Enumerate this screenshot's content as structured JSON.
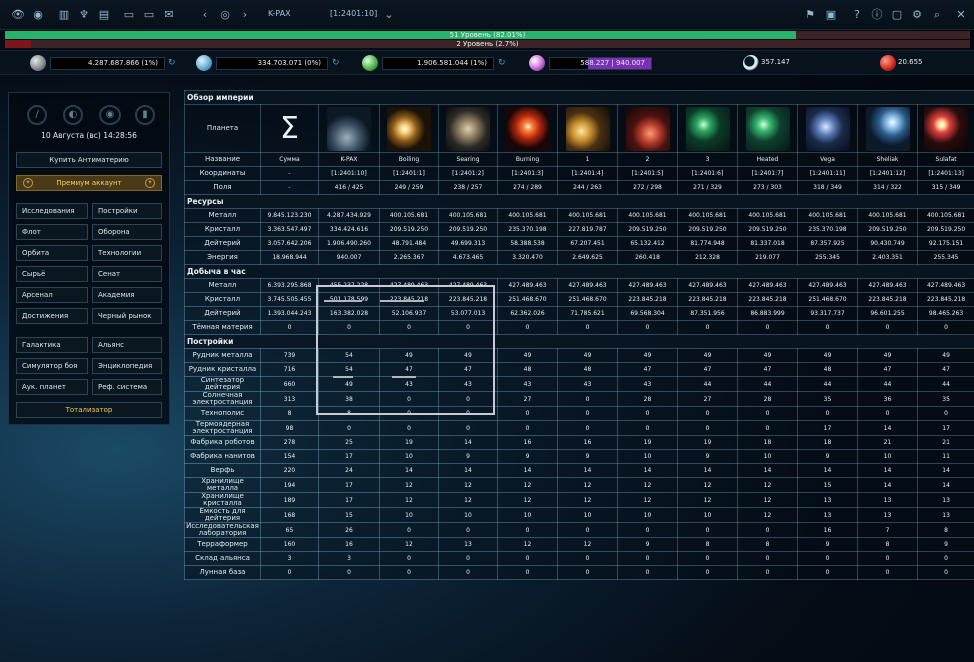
{
  "topbar": {
    "planet_name": "K-PAX",
    "coords": "[1:2401:10]"
  },
  "levels": {
    "level1": "51 Уровень (82.01%)",
    "level1_pct": 82.01,
    "level2": "2 Уровень (2.7%)",
    "level2_pct": 2.7,
    "level1_color": "#27b36b",
    "level2_color": "#7c161a"
  },
  "resources": [
    {
      "name": "metal",
      "icon": "metal-icon",
      "value": "4.287.687.866 (1%)"
    },
    {
      "name": "crystal",
      "icon": "crystal-icon",
      "value": "334.703.071 (0%)"
    },
    {
      "name": "deuterium",
      "icon": "deuterium-icon",
      "value": "1.906.581.044 (1%)"
    },
    {
      "name": "energy",
      "icon": "energy-icon",
      "value": "588.227",
      "max": "940.007",
      "fill_pct": 38
    },
    {
      "name": "dark-matter",
      "icon": "dark-matter-icon",
      "value": "357.147"
    },
    {
      "name": "antimatter",
      "icon": "antimatter-icon",
      "value": "20.655"
    }
  ],
  "sidebar": {
    "datetime": "10 Августа (вс) 14:28:56",
    "buy": "Купить Антиматерию",
    "premium": "Премиум аккаунт",
    "nav": [
      "Исследования",
      "Постройки",
      "Флот",
      "Оборона",
      "Орбита",
      "Технологии",
      "Сырьё",
      "Сенат",
      "Арсенал",
      "Академия",
      "Достижения",
      "Черный рынок"
    ],
    "nav2": [
      "Галактика",
      "Альянс",
      "Симулятор боя",
      "Энциклопедия",
      "Аук. планет",
      "Реф. система"
    ],
    "totalizator": "Тотализатор"
  },
  "overview": {
    "title": "Обзор империи",
    "planet_label": "Планета",
    "sigma": "Σ",
    "rows": [
      {
        "label": "Название",
        "values": [
          "Сумма",
          "K-PAX",
          "Boiling",
          "Searing",
          "Burning",
          "1",
          "2",
          "3",
          "Heated",
          "Vega",
          "Sheliak",
          "Sulafat"
        ]
      },
      {
        "label": "Координаты",
        "values": [
          "-",
          "[1:2401:10]",
          "[1:2401:1]",
          "[1:2401:2]",
          "[1:2401:3]",
          "[1:2401:4]",
          "[1:2401:5]",
          "[1:2401:6]",
          "[1:2401:7]",
          "[1:2401:11]",
          "[1:2401:12]",
          "[1:2401:13]"
        ]
      },
      {
        "label": "Поля",
        "values": [
          "-",
          "416 / 425",
          "249 / 259",
          "238 / 257",
          "274 / 289",
          "244 / 263",
          "272 / 298",
          "271 / 329",
          "273 / 303",
          "318 / 349",
          "314 / 322",
          "315 / 349"
        ]
      }
    ]
  },
  "resources_section": {
    "title": "Ресурсы",
    "rows": [
      {
        "label": "Металл",
        "values": [
          "9.845.123.230",
          "4.287.434.929",
          "400.105.681",
          "400.105.681",
          "400.105.681",
          "400.105.681",
          "400.105.681",
          "400.105.681",
          "400.105.681",
          "400.105.681",
          "400.105.681",
          "400.105.681"
        ]
      },
      {
        "label": "Кристалл",
        "values": [
          "3.363.547.497",
          "334.424.616",
          "209.519.250",
          "209.519.250",
          "235.370.198",
          "227.819.787",
          "209.519.250",
          "209.519.250",
          "209.519.250",
          "235.370.198",
          "209.519.250",
          "209.519.250"
        ]
      },
      {
        "label": "Дейтерий",
        "values": [
          "3.057.642.206",
          "1.906.490.260",
          "48.791.484",
          "49.699.313",
          "58.388.538",
          "67.207.451",
          "65.132.412",
          "81.774.948",
          "81.337.018",
          "87.357.925",
          "90.430.749",
          "92.175.151"
        ]
      },
      {
        "label": "Энергия",
        "values": [
          "18.968.944",
          "940.007",
          "2.265.367",
          "4.673.465",
          "3.320.470",
          "2.649.625",
          "260.418",
          "212.328",
          "219.077",
          "255.345",
          "2.403.351",
          "255.345"
        ]
      }
    ]
  },
  "production_section": {
    "title": "Добыча в час",
    "rows": [
      {
        "label": "Металл",
        "values": [
          "6.393.295.868",
          "455.237.228",
          "427.489.463",
          "427.489.463",
          "427.489.463",
          "427.489.463",
          "427.489.463",
          "427.489.463",
          "427.489.463",
          "427.489.463",
          "427.489.463",
          "427.489.463"
        ]
      },
      {
        "label": "Кристалл",
        "values": [
          "3.745.505.455",
          "501.178.599",
          "223.845.218",
          "223.845.218",
          "251.468.670",
          "251.468.670",
          "223.845.218",
          "223.845.218",
          "223.845.218",
          "251.468.670",
          "223.845.218",
          "223.845.218"
        ]
      },
      {
        "label": "Дейтерий",
        "values": [
          "1.393.044.243",
          "163.382.028",
          "52.106.937",
          "53.077.013",
          "62.362.026",
          "71.785.621",
          "69.568.304",
          "87.351.956",
          "86.883.999",
          "93.317.737",
          "96.601.255",
          "98.465.263"
        ]
      },
      {
        "label": "Тёмная материя",
        "values": [
          "0",
          "0",
          "0",
          "0",
          "0",
          "0",
          "0",
          "0",
          "0",
          "0",
          "0",
          "0"
        ]
      }
    ]
  },
  "buildings_section": {
    "title": "Постройки",
    "rows": [
      {
        "label": "Рудник металла",
        "values": [
          "739",
          "54",
          "49",
          "49",
          "49",
          "49",
          "49",
          "49",
          "49",
          "49",
          "49",
          "49"
        ]
      },
      {
        "label": "Рудник кристалла",
        "values": [
          "716",
          "54",
          "47",
          "47",
          "48",
          "48",
          "47",
          "47",
          "47",
          "48",
          "47",
          "47"
        ]
      },
      {
        "label": "Синтезатор дейтерия",
        "values": [
          "660",
          "49",
          "43",
          "43",
          "43",
          "43",
          "43",
          "44",
          "44",
          "44",
          "44",
          "44"
        ]
      },
      {
        "label": "Солнечная электростанция",
        "values": [
          "313",
          "38",
          "0",
          "0",
          "27",
          "0",
          "28",
          "27",
          "28",
          "35",
          "36",
          "35"
        ]
      },
      {
        "label": "Технополис",
        "values": [
          "8",
          "8",
          "0",
          "0",
          "0",
          "0",
          "0",
          "0",
          "0",
          "0",
          "0",
          "0"
        ]
      },
      {
        "label": "Термоядерная электростанция",
        "values": [
          "98",
          "0",
          "0",
          "0",
          "0",
          "0",
          "0",
          "0",
          "0",
          "17",
          "14",
          "17"
        ]
      },
      {
        "label": "Фабрика роботов",
        "values": [
          "278",
          "25",
          "19",
          "14",
          "16",
          "16",
          "19",
          "19",
          "18",
          "18",
          "21",
          "21"
        ]
      },
      {
        "label": "Фабрика нанитов",
        "values": [
          "154",
          "17",
          "10",
          "9",
          "9",
          "9",
          "10",
          "9",
          "10",
          "9",
          "10",
          "11"
        ]
      },
      {
        "label": "Верфь",
        "values": [
          "220",
          "24",
          "14",
          "14",
          "14",
          "14",
          "14",
          "14",
          "14",
          "14",
          "14",
          "14"
        ]
      },
      {
        "label": "Хранилище металла",
        "values": [
          "194",
          "17",
          "12",
          "12",
          "12",
          "12",
          "12",
          "12",
          "12",
          "15",
          "14",
          "14"
        ]
      },
      {
        "label": "Хранилище кристалла",
        "values": [
          "189",
          "17",
          "12",
          "12",
          "12",
          "12",
          "12",
          "12",
          "12",
          "13",
          "13",
          "13"
        ]
      },
      {
        "label": "Ёмкость для дейтерия",
        "values": [
          "168",
          "15",
          "10",
          "10",
          "10",
          "10",
          "10",
          "10",
          "12",
          "13",
          "13",
          "13"
        ]
      },
      {
        "label": "Исследовательская лаборатория",
        "values": [
          "65",
          "26",
          "0",
          "0",
          "0",
          "0",
          "0",
          "0",
          "0",
          "16",
          "7",
          "8"
        ]
      },
      {
        "label": "Терраформер",
        "values": [
          "160",
          "16",
          "12",
          "13",
          "12",
          "12",
          "9",
          "8",
          "8",
          "9",
          "8",
          "9"
        ]
      },
      {
        "label": "Склад альянса",
        "values": [
          "3",
          "3",
          "0",
          "0",
          "0",
          "0",
          "0",
          "0",
          "0",
          "0",
          "0",
          "0"
        ]
      },
      {
        "label": "Лунная база",
        "values": [
          "0",
          "0",
          "0",
          "0",
          "0",
          "0",
          "0",
          "0",
          "0",
          "0",
          "0",
          "0"
        ]
      }
    ]
  },
  "colors": {
    "accent": "#f3c94f",
    "border": "#2a4556",
    "energy_fill": "#7a2fb4"
  }
}
